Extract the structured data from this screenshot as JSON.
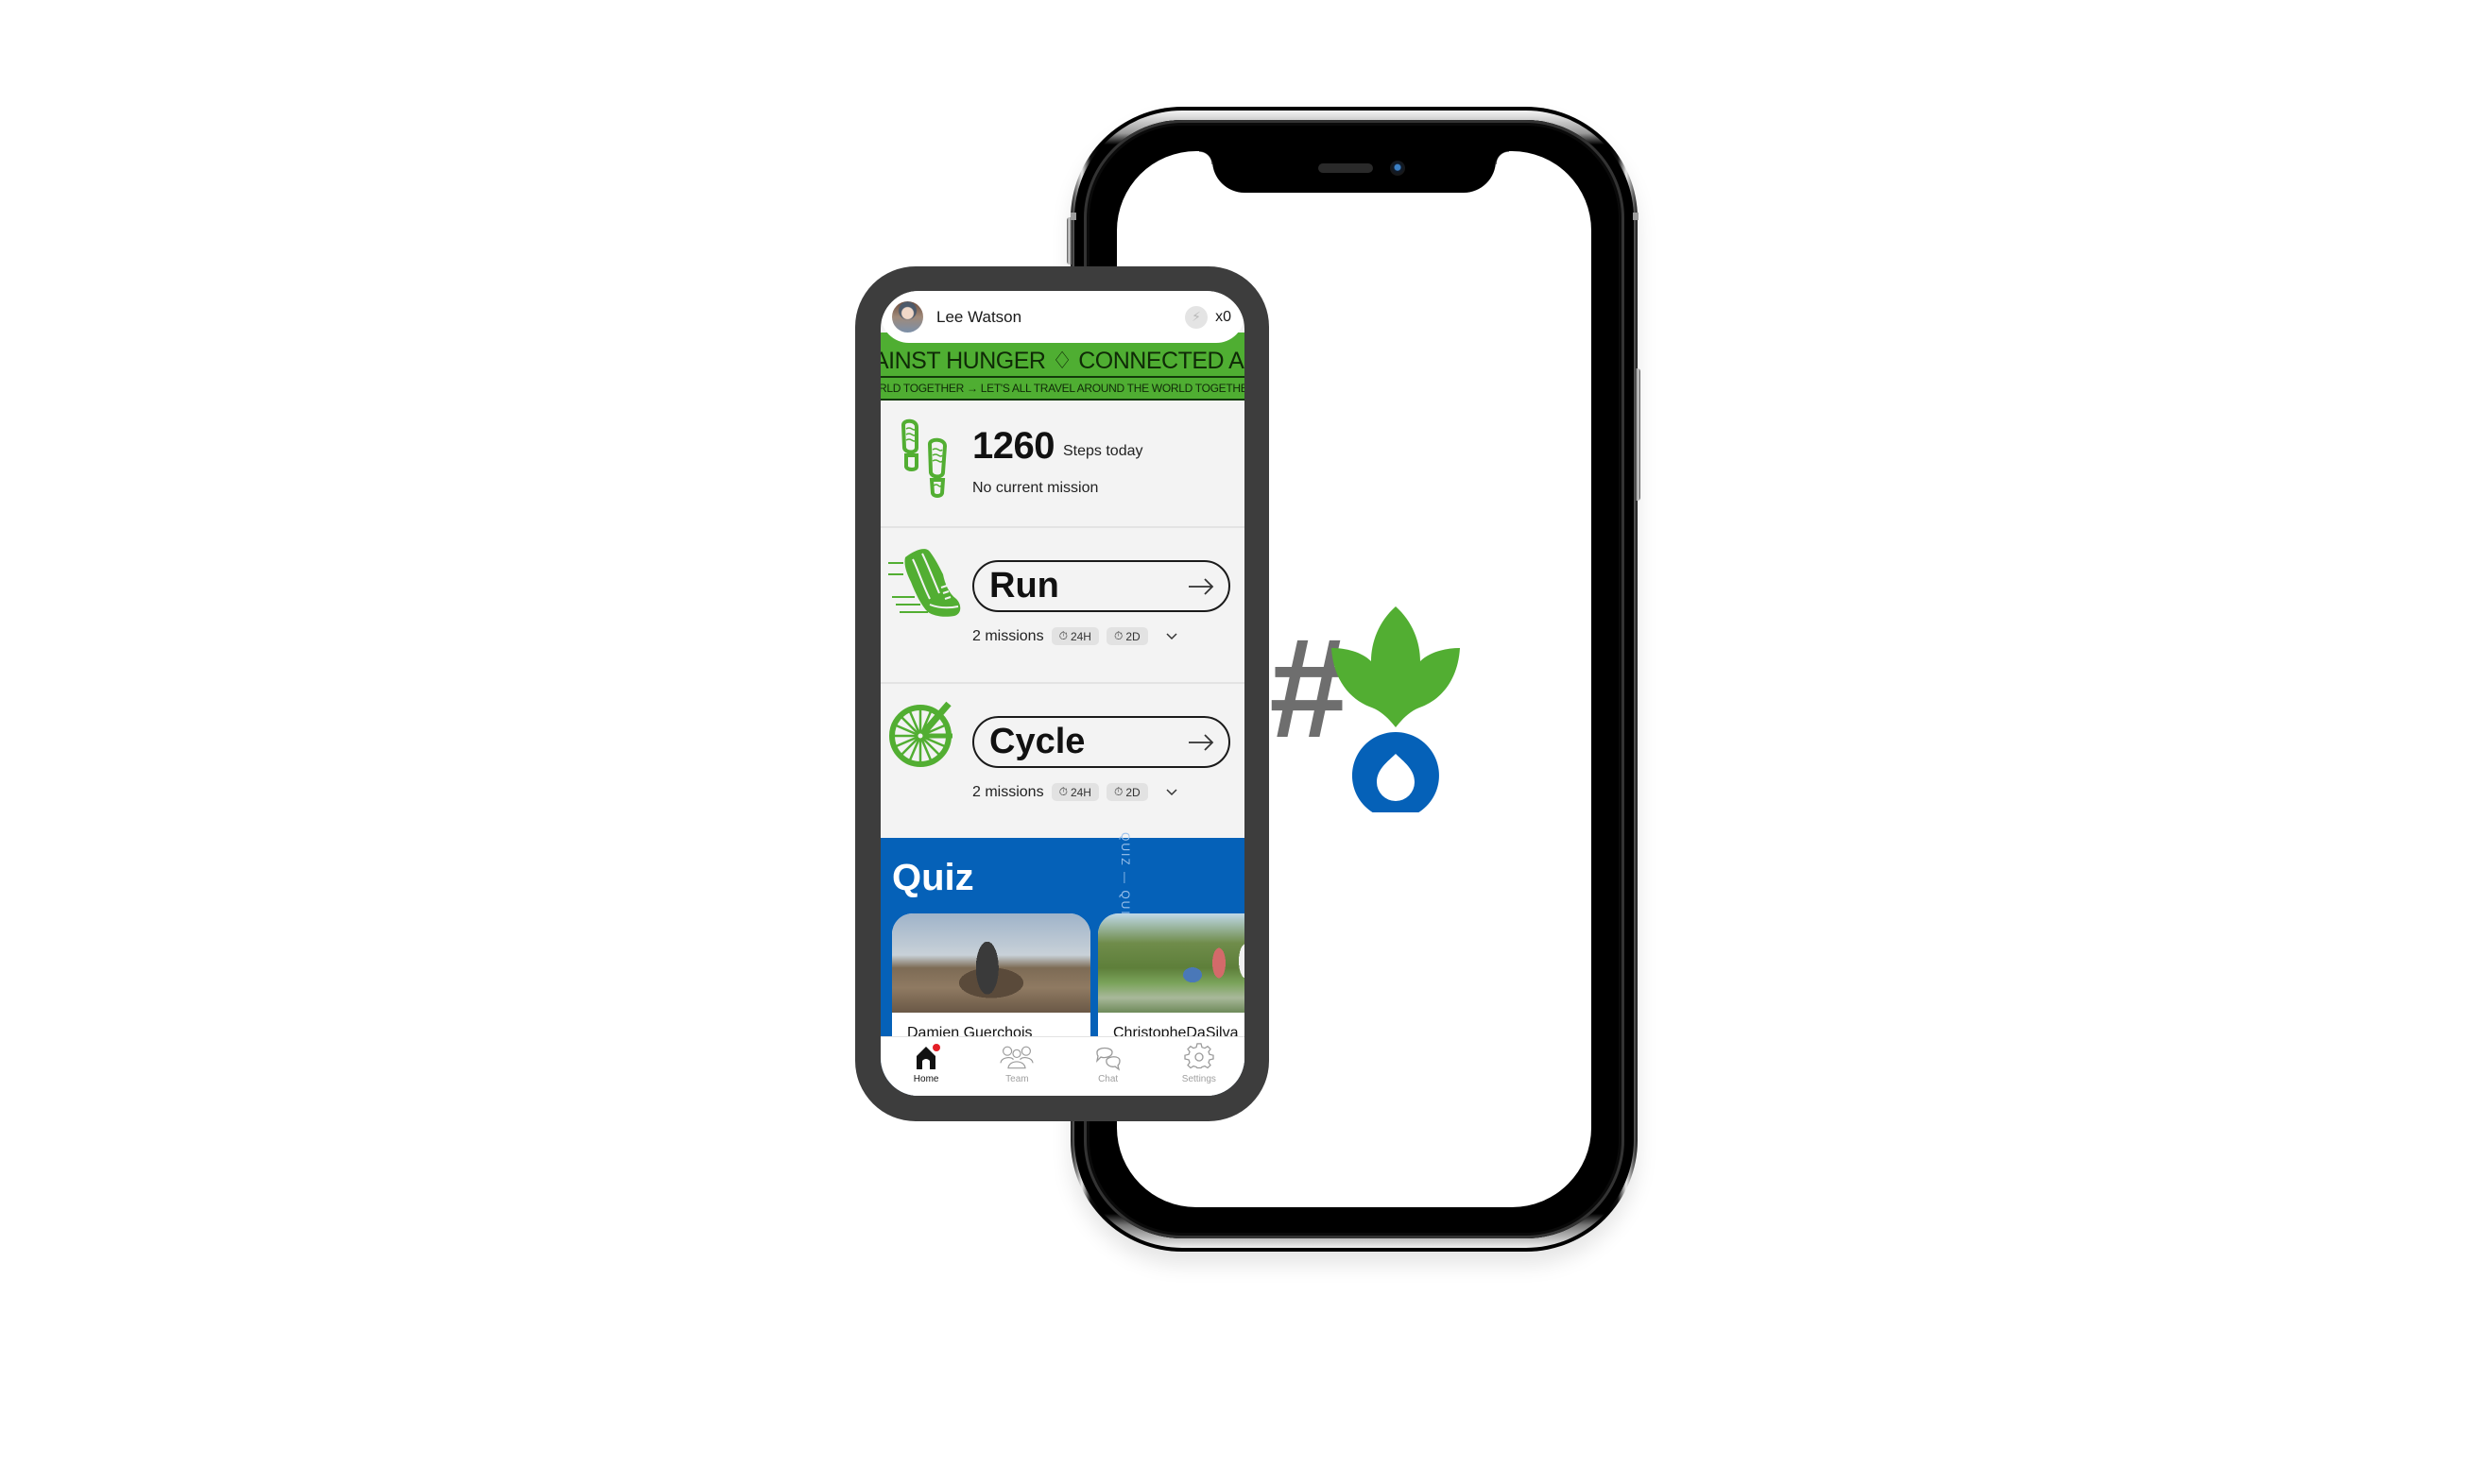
{
  "header": {
    "user_name": "Lee Watson",
    "energy_icon": "lightning-icon",
    "energy_count": "x0"
  },
  "banner": {
    "line1": "AINST HUNGER ♢ CONNECTED AGAINST HUNGER",
    "line2": "RLD TOGETHER →   LET'S ALL TRAVEL AROUND THE WORLD TOGETHER →"
  },
  "steps": {
    "icon": "footprints-icon",
    "count": "1260",
    "label": "Steps today",
    "mission_status": "No current mission"
  },
  "activities": [
    {
      "name": "Run",
      "icon": "running-shoe-icon",
      "missions": "2 missions",
      "chips": [
        "24H",
        "2D"
      ]
    },
    {
      "name": "Cycle",
      "icon": "bicycle-wheel-icon",
      "missions": "2 missions",
      "chips": [
        "24H",
        "2D"
      ]
    }
  ],
  "quiz": {
    "title": "Quiz",
    "vertical_text": "QUIZ — QUIZ",
    "cards": [
      {
        "author": "Damien Guerchois"
      },
      {
        "author": "ChristopheDaSilva"
      }
    ]
  },
  "nav": {
    "items": [
      {
        "label": "Home",
        "icon": "home-icon",
        "active": true,
        "badge": true
      },
      {
        "label": "Team",
        "icon": "team-icon",
        "active": false
      },
      {
        "label": "Chat",
        "icon": "chat-icon",
        "active": false
      },
      {
        "label": "Settings",
        "icon": "gear-icon",
        "active": false
      }
    ]
  },
  "logo": {
    "symbol": "#",
    "colors": {
      "hash": "#6e6e6e",
      "leaf": "#52ae32",
      "drop": "#0561b8"
    }
  },
  "colors": {
    "banner_green": "#4fae32",
    "quiz_blue": "#0561b8",
    "frame_gray": "#3d3d3d",
    "notification_red": "#e41e26"
  }
}
